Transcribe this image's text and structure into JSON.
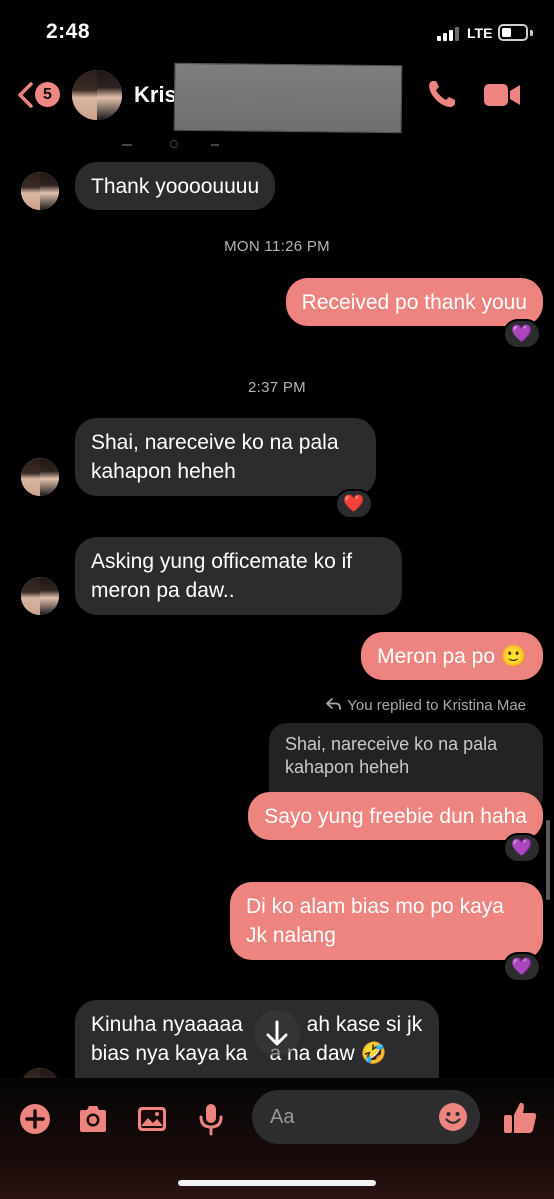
{
  "status_bar": {
    "time": "2:48",
    "network": "LTE"
  },
  "header": {
    "back_count": "5",
    "contact_name": "Kris"
  },
  "messages": [
    {
      "id": "m1",
      "text": "Thank yoooouuuu"
    },
    {
      "id": "m2",
      "text": "Received po thank youu",
      "reaction": "💜"
    },
    {
      "id": "m3",
      "text_lines": [
        "Shai, nareceive ko na pala",
        "kahapon heheh"
      ],
      "reaction": "❤️"
    },
    {
      "id": "m4",
      "text_lines": [
        "Asking yung officemate ko if",
        "meron pa daw.."
      ]
    },
    {
      "id": "m5",
      "text": "Meron pa po 🙂"
    },
    {
      "id": "m6",
      "reply_note": "You replied to Kristina Mae",
      "quote_lines": [
        "Shai, nareceive ko na pala",
        "kahapon heheh"
      ],
      "text": "Sayo yung freebie dun haha",
      "reaction": "💜"
    },
    {
      "id": "m7",
      "text_lines": [
        "Di ko alam bias mo po kaya",
        "Jk nalang"
      ],
      "reaction": "💜"
    },
    {
      "id": "m8",
      "text_lines": [
        "Kinuha nyaaaaa ",
        "ah kase si jk",
        "bias nya kaya ka",
        "a na daw 🤣"
      ]
    }
  ],
  "timestamps": [
    "MON 11:26 PM",
    "2:37 PM"
  ],
  "composer": {
    "placeholder": "Aa"
  },
  "colors": {
    "accent": "#ee8480",
    "incoming_bubble": "#2c2c2e",
    "background": "#000000"
  },
  "icons": [
    "back-chevron-icon",
    "phone-icon",
    "video-camera-icon",
    "plus-icon",
    "camera-icon",
    "image-icon",
    "microphone-icon",
    "emoji-icon",
    "thumbs-up-icon",
    "arrow-down-icon",
    "reply-arrow-icon"
  ]
}
